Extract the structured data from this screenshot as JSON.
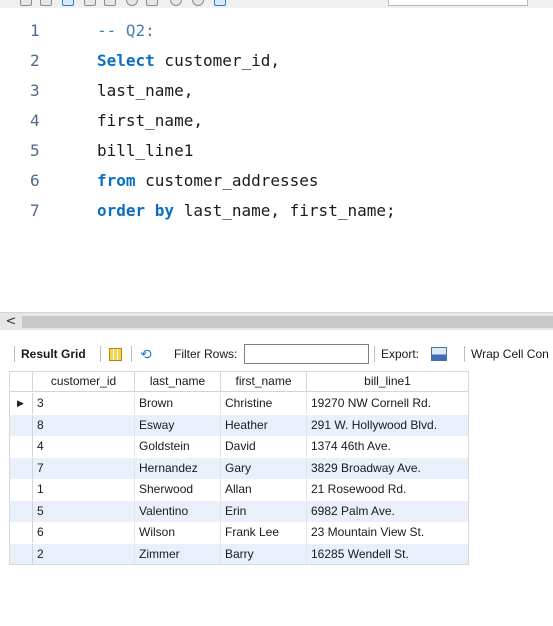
{
  "toolbar": {
    "icons": [
      "open-file-icon",
      "save-icon",
      "execute-icon",
      "execute-line-icon",
      "explain-icon",
      "stop-icon",
      "toggle-icon",
      "commit-icon",
      "rollback-icon",
      "autocommit-icon"
    ]
  },
  "editor": {
    "lines": [
      {
        "num": "1",
        "tokens": [
          {
            "t": "-- Q2:",
            "c": "cmt"
          }
        ]
      },
      {
        "num": "2",
        "tokens": [
          {
            "t": "Select",
            "c": "kw"
          },
          {
            "t": " customer_id,",
            "c": ""
          }
        ]
      },
      {
        "num": "3",
        "tokens": [
          {
            "t": "last_name,",
            "c": ""
          }
        ]
      },
      {
        "num": "4",
        "tokens": [
          {
            "t": "first_name,",
            "c": ""
          }
        ]
      },
      {
        "num": "5",
        "tokens": [
          {
            "t": "bill_line1",
            "c": ""
          }
        ]
      },
      {
        "num": "6",
        "tokens": [
          {
            "t": "from",
            "c": "kw"
          },
          {
            "t": " customer_addresses",
            "c": ""
          }
        ]
      },
      {
        "num": "7",
        "tokens": [
          {
            "t": "order by",
            "c": "kw"
          },
          {
            "t": " last_name, first_name;",
            "c": ""
          }
        ]
      }
    ]
  },
  "scrollbar": {
    "left_arrow": "<"
  },
  "result_toolbar": {
    "grid_label": "Result Grid",
    "filter_label": "Filter Rows:",
    "filter_value": "",
    "export_label": "Export:",
    "wrap_label": "Wrap Cell Con"
  },
  "grid": {
    "columns": [
      "customer_id",
      "last_name",
      "first_name",
      "bill_line1"
    ],
    "current_row_marker": "▶",
    "rows": [
      [
        "3",
        "Brown",
        "Christine",
        "19270 NW Cornell Rd."
      ],
      [
        "8",
        "Esway",
        "Heather",
        "291 W. Hollywood Blvd."
      ],
      [
        "4",
        "Goldstein",
        "David",
        "1374 46th Ave."
      ],
      [
        "7",
        "Hernandez",
        "Gary",
        "3829 Broadway Ave."
      ],
      [
        "1",
        "Sherwood",
        "Allan",
        "21 Rosewood Rd."
      ],
      [
        "5",
        "Valentino",
        "Erin",
        "6982 Palm Ave."
      ],
      [
        "6",
        "Wilson",
        "Frank Lee",
        "23 Mountain View St."
      ],
      [
        "2",
        "Zimmer",
        "Barry",
        "16285 Wendell St."
      ]
    ]
  }
}
